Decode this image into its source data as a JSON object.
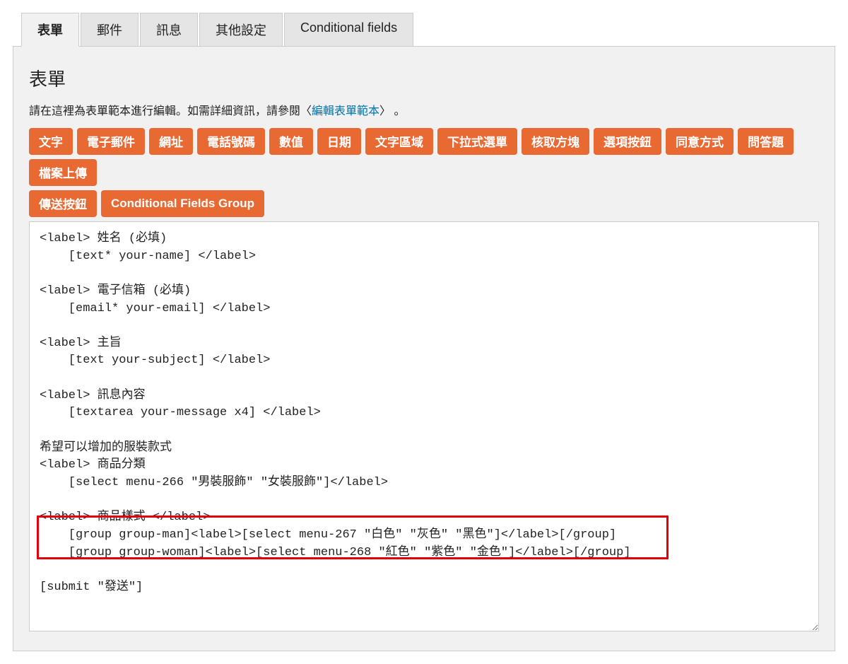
{
  "tabs": {
    "items": [
      {
        "label": "表單",
        "active": true
      },
      {
        "label": "郵件",
        "active": false
      },
      {
        "label": "訊息",
        "active": false
      },
      {
        "label": "其他設定",
        "active": false
      },
      {
        "label": "Conditional fields",
        "active": false
      }
    ]
  },
  "section": {
    "title": "表單",
    "helper_prefix": "請在這裡為表單範本進行編輯。如需詳細資訊，請參閱〈",
    "helper_link": "編輯表單範本",
    "helper_suffix": "〉 。"
  },
  "tag_buttons": {
    "row1": [
      "文字",
      "電子郵件",
      "網址",
      "電話號碼",
      "數值",
      "日期",
      "文字區域",
      "下拉式選單",
      "核取方塊",
      "選項按鈕",
      "同意方式",
      "問答題",
      "檔案上傳"
    ],
    "row2": [
      "傳送按鈕",
      "Conditional Fields Group"
    ]
  },
  "code": "<label> 姓名 (必填)\n    [text* your-name] </label>\n\n<label> 電子信箱 (必填)\n    [email* your-email] </label>\n\n<label> 主旨\n    [text your-subject] </label>\n\n<label> 訊息內容\n    [textarea your-message x4] </label>\n\n希望可以增加的服裝款式\n<label> 商品分類\n    [select menu-266 \"男裝服飾\" \"女裝服飾\"]</label>\n\n<label> 商品樣式 </label>\n    [group group-man]<label>[select menu-267 \"白色\" \"灰色\" \"黑色\"]</label>[/group]\n    [group group-woman]<label>[select menu-268 \"紅色\" \"紫色\" \"金色\"]</label>[/group]\n\n[submit \"發送\"]"
}
